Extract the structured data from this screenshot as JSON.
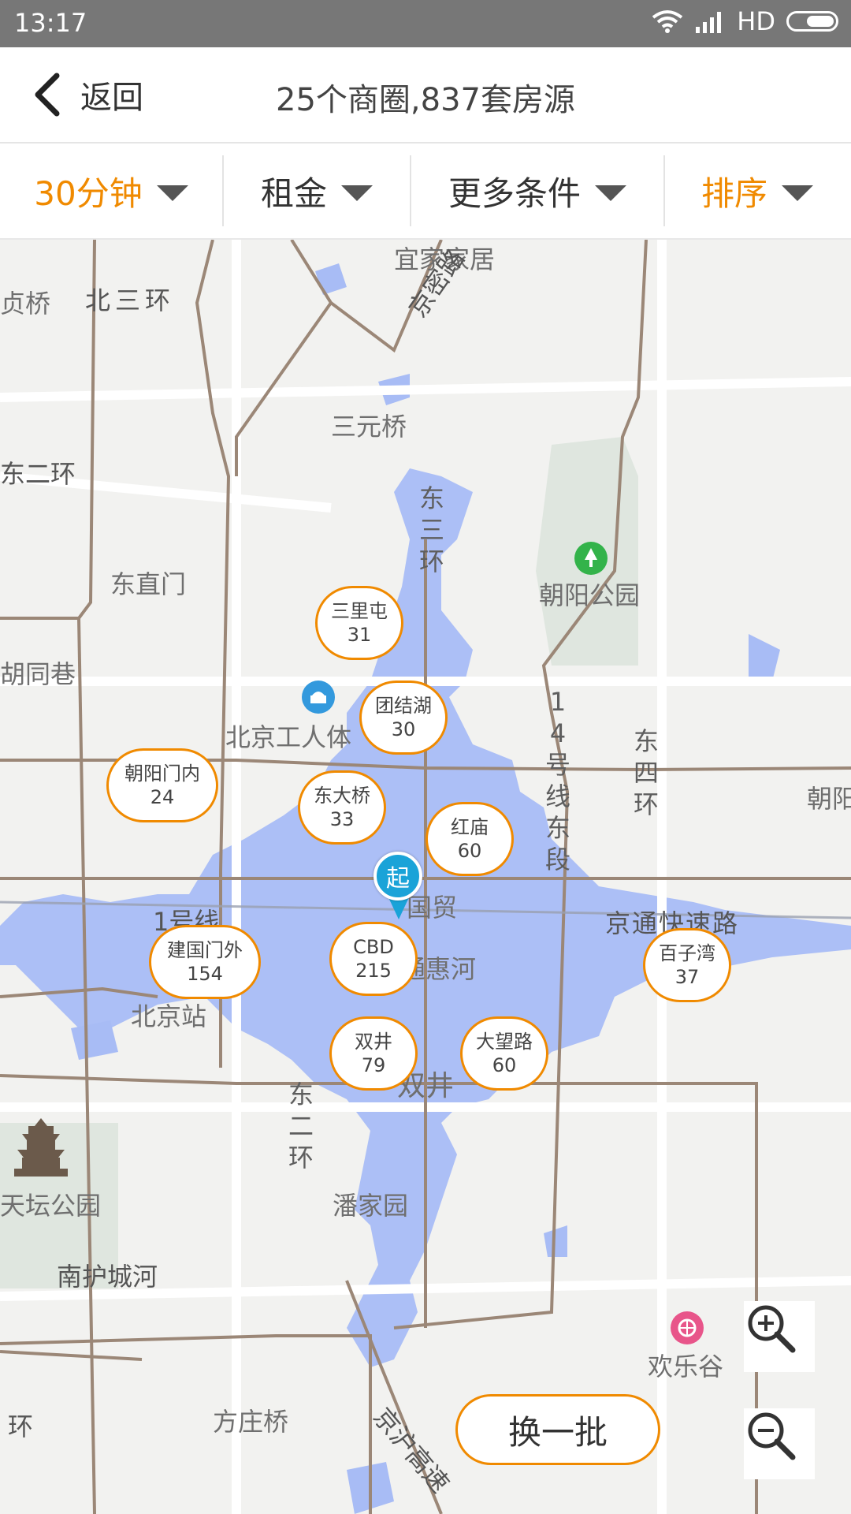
{
  "status_bar": {
    "time": "13:17",
    "network": "HD"
  },
  "header": {
    "back_label": "返回",
    "title": "25个商圈,837套房源"
  },
  "filters": [
    {
      "label": "30分钟",
      "active": true
    },
    {
      "label": "租金",
      "active": false
    },
    {
      "label": "更多条件",
      "active": false
    },
    {
      "label": "排序",
      "active": true
    }
  ],
  "map": {
    "labels": [
      "宜家家居",
      "北三环",
      "贞桥",
      "京密路",
      "三元桥",
      "东三环",
      "东二环",
      "东直门",
      "朝阳公园",
      "三里屯",
      "胡同巷",
      "北京工人体",
      "14号线东段",
      "东四环",
      "朝阳",
      "1号线",
      "国贸",
      "京通快速路",
      "北京站",
      "通惠河",
      "东二环",
      "双井",
      "天坛公园",
      "潘家园",
      "南护城河",
      "欢乐谷",
      "方庄桥",
      "环",
      "京沪高速"
    ],
    "districts": [
      {
        "name": "三里屯",
        "count": "31"
      },
      {
        "name": "团结湖",
        "count": "30"
      },
      {
        "name": "朝阳门内",
        "count": "24"
      },
      {
        "name": "东大桥",
        "count": "33"
      },
      {
        "name": "红庙",
        "count": "60"
      },
      {
        "name": "建国门外",
        "count": "154"
      },
      {
        "name": "CBD",
        "count": "215"
      },
      {
        "name": "百子湾",
        "count": "37"
      },
      {
        "name": "双井",
        "count": "79"
      },
      {
        "name": "大望路",
        "count": "60"
      }
    ],
    "start_marker": "起"
  },
  "controls": {
    "swap_label": "换一批",
    "zoom_in_icon": "zoom-in-icon",
    "zoom_out_icon": "zoom-out-icon"
  },
  "colors": {
    "accent": "#f08a00",
    "coverage": "#a8bcf5",
    "pin": "#1aa3d8"
  }
}
